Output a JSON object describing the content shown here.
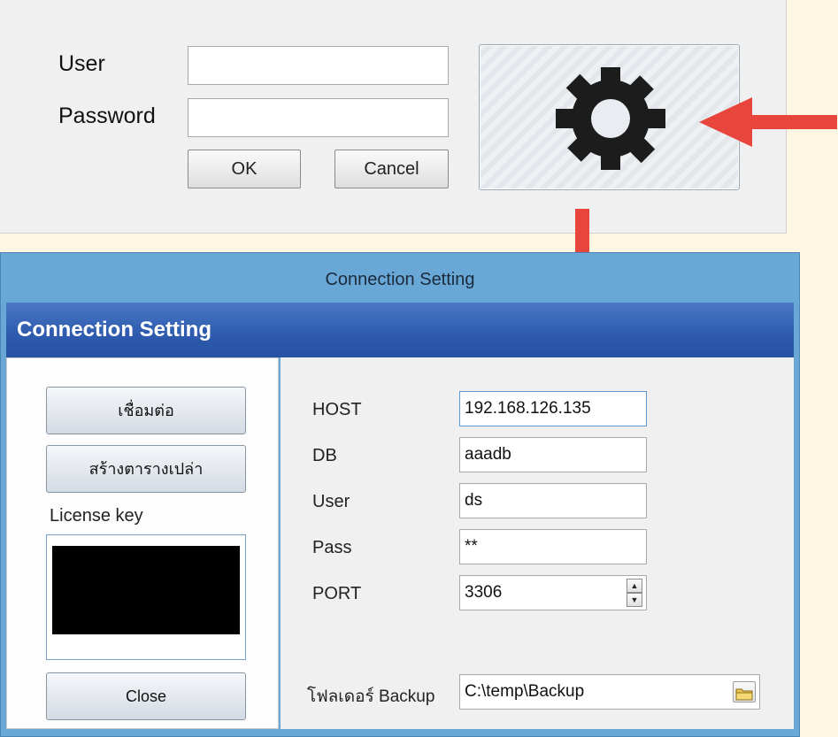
{
  "login": {
    "user_label": "User",
    "password_label": "Password",
    "user_value": "",
    "password_value": "",
    "ok_label": "OK",
    "cancel_label": "Cancel",
    "settings_icon": "gear-icon"
  },
  "connection": {
    "window_title": "Connection Setting",
    "header_title": "Connection Setting",
    "connect_label": "เชื่อมต่อ",
    "create_table_label": "สร้างตารางเปล่า",
    "license_label": "License key",
    "license_value": "",
    "close_label": "Close",
    "fields": {
      "host_label": "HOST",
      "host_value": "192.168.126.135",
      "db_label": "DB",
      "db_value": "aaadb",
      "user_label": "User",
      "user_value": "ds",
      "pass_label": "Pass",
      "pass_value": "**",
      "port_label": "PORT",
      "port_value": "3306",
      "backup_label": "โฟลเดอร์ Backup",
      "backup_value": "C:\\temp\\Backup"
    }
  },
  "colors": {
    "arrow": "#e8453c",
    "header_blue": "#2f5cae",
    "window_blue": "#69a8d6"
  }
}
